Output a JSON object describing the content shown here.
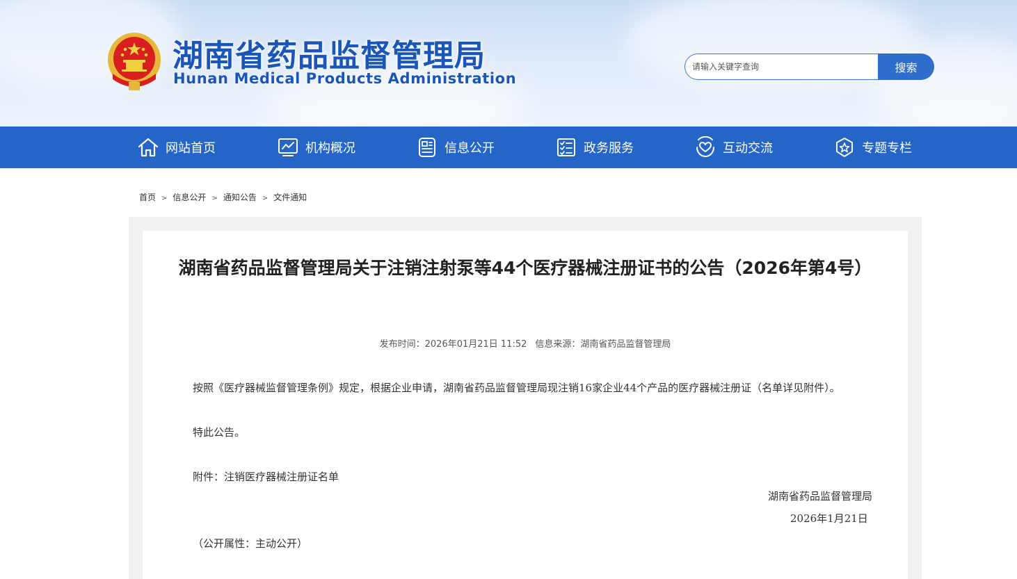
{
  "header": {
    "title_cn": "湖南省药品监督管理局",
    "title_en": "Hunan Medical Products Administration",
    "search_placeholder": "请输入关键字查询",
    "search_button": "搜索"
  },
  "nav": {
    "items": [
      {
        "label": "网站首页",
        "icon": "home-icon"
      },
      {
        "label": "机构概况",
        "icon": "chart-monitor-icon"
      },
      {
        "label": "信息公开",
        "icon": "document-icon"
      },
      {
        "label": "政务服务",
        "icon": "checklist-icon"
      },
      {
        "label": "互动交流",
        "icon": "heart-hands-icon"
      },
      {
        "label": "专题专栏",
        "icon": "star-badge-icon"
      }
    ]
  },
  "breadcrumb": [
    "首页",
    "信息公开",
    "通知公告",
    "文件通知"
  ],
  "breadcrumb_separator": ">",
  "article": {
    "title": "湖南省药品监督管理局关于注销注射泵等44个医疗器械注册证书的公告（2026年第4号）",
    "publish_time": "发布时间：2026年01月21日 11:52",
    "source": "信息来源：湖南省药品监督管理局",
    "paragraph1": "按照《医疗器械监督管理条例》规定，根据企业申请，湖南省药品监督管理局现注销16家企业44个产品的医疗器械注册证（名单详见附件）。",
    "paragraph2": "特此公告。",
    "attachment": "附件：注销医疗器械注册证名单",
    "signature_org": "湖南省药品监督管理局",
    "signature_date": "2026年1月21日",
    "disclosure": "（公开属性：主动公开）"
  },
  "colors": {
    "brand_blue": "#2565c8",
    "title_blue": "#1a55b8"
  }
}
